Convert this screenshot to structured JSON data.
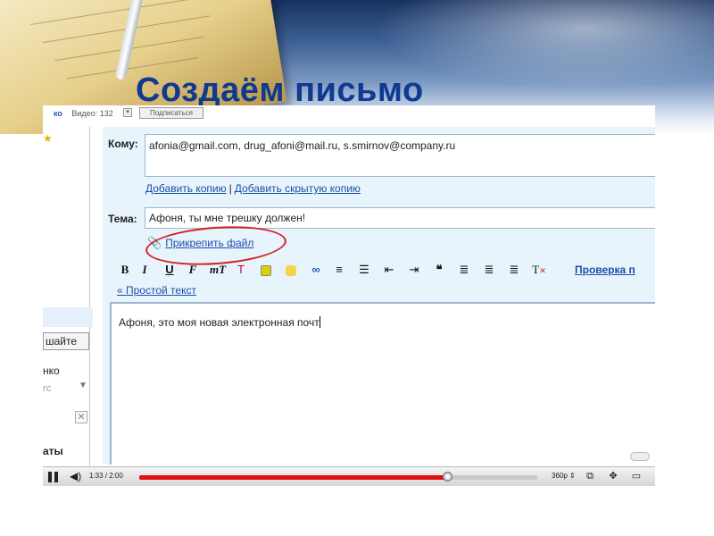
{
  "slide": {
    "title": "Создаём письмо"
  },
  "youtube_strip": {
    "partial_link": "ко",
    "views_label": "Видео: 132",
    "subscribe_label": "Подписаться"
  },
  "left_panel": {
    "button_text": "шайте",
    "text_1": "нко",
    "text_2": "гс",
    "text_3": "аты"
  },
  "compose": {
    "to_label": "Кому:",
    "to_value": "afonia@gmail.com,  drug_afoni@mail.ru,  s.smirnov@company.ru",
    "add_cc": "Добавить копию",
    "separator": "|",
    "add_bcc": "Добавить скрытую копию",
    "subject_label": "Тема:",
    "subject_value": "Афоня,  ты  мне  трешку  должен!",
    "attach_label": "Прикрепить файл",
    "toolbar": {
      "bold": "B",
      "italic": "I",
      "underline": "U",
      "font": "F",
      "size": "тT",
      "spell_check": "Проверка п"
    },
    "plain_text_link": "« Простой текст",
    "body_text": "Афоня,  это  моя  новая  электронная  почт"
  },
  "player": {
    "time": "1:33 / 2:00",
    "quality": "360p",
    "progress": 0.775
  },
  "colors": {
    "title": "#0f3a8f",
    "link": "#1c4ea8",
    "highlight_ellipse": "#d42020",
    "compose_bg": "#e8f4fc",
    "progress": "#e01010"
  }
}
